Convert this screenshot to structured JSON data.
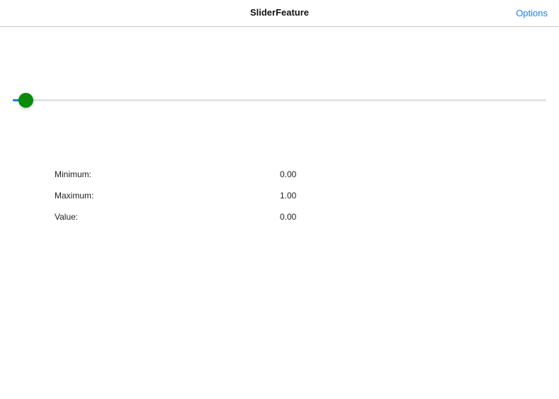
{
  "nav": {
    "title": "SliderFeature",
    "options_label": "Options"
  },
  "slider": {
    "minimum": 0,
    "maximum": 1,
    "value": 0,
    "thumb_color": "#0a8a0a",
    "fill_color": "#1a7cf5",
    "track_color": "#e3e3e3"
  },
  "info": [
    {
      "label": "Minimum:",
      "value": "0.00"
    },
    {
      "label": "Maximum:",
      "value": "1.00"
    },
    {
      "label": "Value:",
      "value": "0.00"
    }
  ]
}
